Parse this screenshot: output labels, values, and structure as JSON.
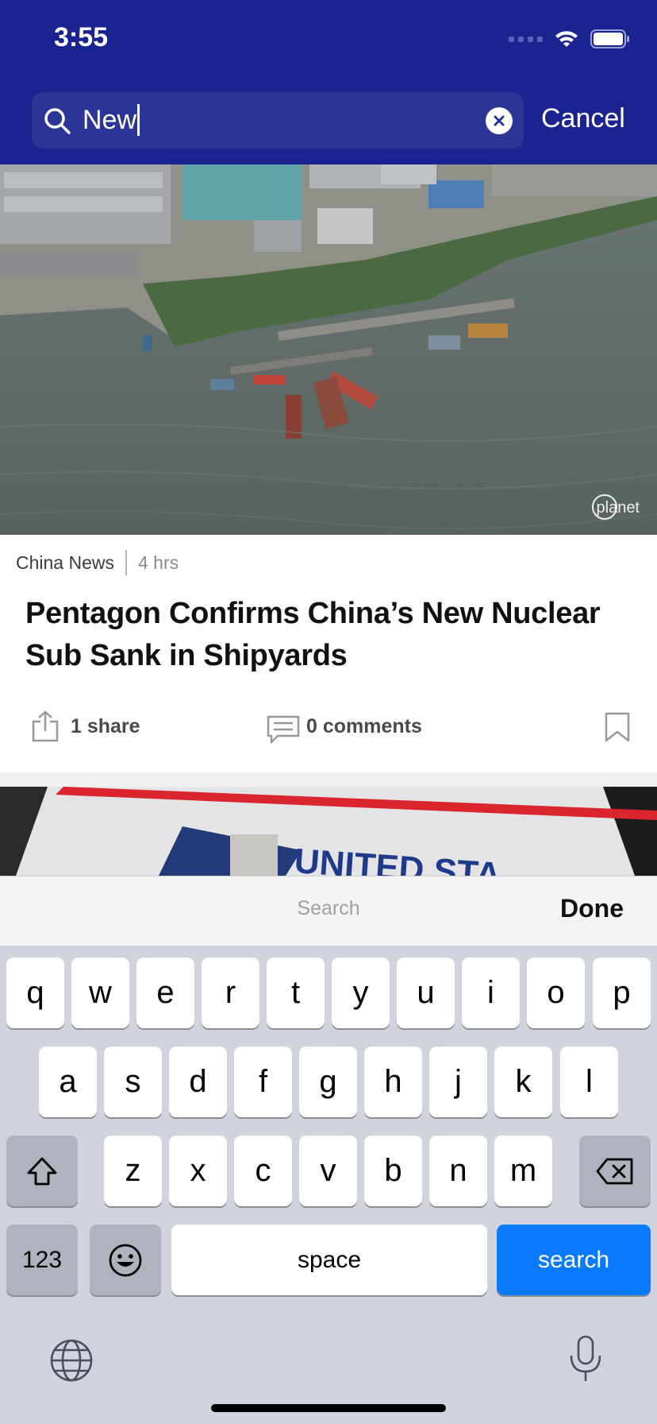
{
  "status_bar": {
    "time": "3:55"
  },
  "search": {
    "query": "New",
    "cancel_label": "Cancel"
  },
  "article": {
    "hero_credit": "planet",
    "category": "China News",
    "age": "4 hrs",
    "headline": "Pentagon Confirms China’s New Nuclear Sub Sank in Shipyards",
    "share_label": "1 share",
    "comments_label": "0 comments"
  },
  "second_article": {
    "image_text": "UNITED STA"
  },
  "keyboard": {
    "accessory_label": "Search",
    "done_label": "Done",
    "row1": [
      "q",
      "w",
      "e",
      "r",
      "t",
      "y",
      "u",
      "i",
      "o",
      "p"
    ],
    "row2": [
      "a",
      "s",
      "d",
      "f",
      "g",
      "h",
      "j",
      "k",
      "l"
    ],
    "row3": [
      "z",
      "x",
      "c",
      "v",
      "b",
      "n",
      "m"
    ],
    "numbers_label": "123",
    "space_label": "space",
    "search_label": "search"
  },
  "colors": {
    "header": "#1a238f",
    "accent": "#0a7aff"
  }
}
